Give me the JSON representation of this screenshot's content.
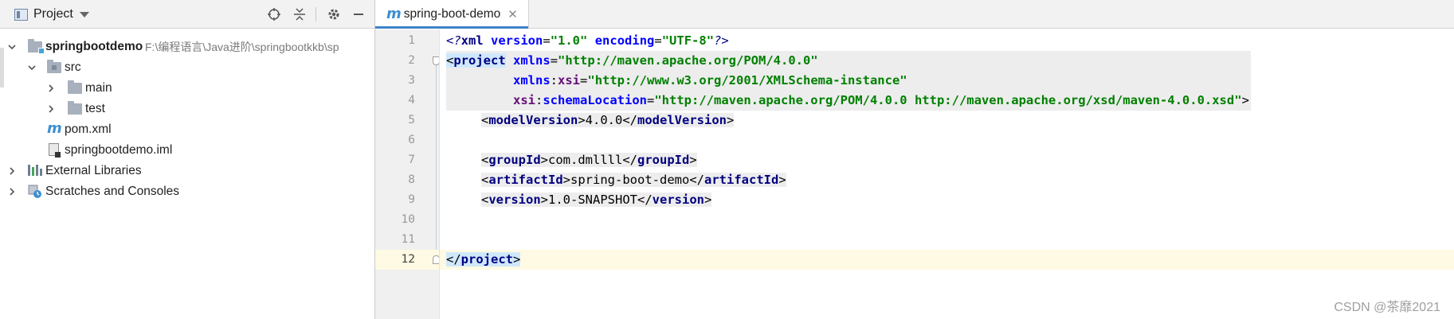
{
  "project_panel": {
    "title": "Project",
    "tree": [
      {
        "label": "springbootdemo",
        "hint": "F:\\编程语言\\Java进阶\\springbootkkb\\sp",
        "expanded": true,
        "icon": "module-folder-icon"
      },
      {
        "label": "src",
        "expanded": true,
        "icon": "source-folder-icon"
      },
      {
        "label": "main",
        "expanded": false,
        "icon": "folder-icon"
      },
      {
        "label": "test",
        "expanded": false,
        "icon": "folder-icon"
      },
      {
        "label": "pom.xml",
        "icon": "maven-icon"
      },
      {
        "label": "springbootdemo.iml",
        "icon": "iml-file-icon"
      },
      {
        "label": "External Libraries",
        "expanded": false,
        "icon": "library-icon"
      },
      {
        "label": "Scratches and Consoles",
        "expanded": false,
        "icon": "scratch-icon"
      }
    ]
  },
  "editor": {
    "tab_label": "spring-boot-demo",
    "line_numbers": [
      "1",
      "2",
      "3",
      "4",
      "5",
      "6",
      "7",
      "8",
      "9",
      "10",
      "11",
      "12"
    ],
    "current_line": 12,
    "code": {
      "l1_open": "<?",
      "l1_xml": "xml",
      "l1_version_attr": "version",
      "l1_version_val": "\"1.0\"",
      "l1_encoding_attr": "encoding",
      "l1_encoding_val": "\"UTF-8\"",
      "l1_close": "?>",
      "project_tag": "project",
      "xmlns_attr": "xmlns",
      "xmlns_val": "\"http://maven.apache.org/POM/4.0.0\"",
      "xsi_prefix": "xmlns",
      "xsi_ns": "xsi",
      "xsi_val": "\"http://www.w3.org/2001/XMLSchema-instance\"",
      "schema_ns": "xsi",
      "schema_attr": "schemaLocation",
      "schema_val": "\"http://maven.apache.org/POM/4.0.0 http://maven.apache.org/xsd/maven-4.0.0.xsd\"",
      "model_version_tag": "modelVersion",
      "model_version_val": "4.0.0",
      "group_id_tag": "groupId",
      "group_id_val": "com.dmllll",
      "artifact_id_tag": "artifactId",
      "artifact_id_val": "spring-boot-demo",
      "version_tag": "version",
      "version_val": "1.0-SNAPSHOT"
    }
  },
  "watermark": "CSDN @茶靡2021",
  "colors": {
    "tag": "#000080",
    "attribute": "#0000ff",
    "namespace": "#660e7a",
    "string": "#008000",
    "current_line": "#fffae3",
    "tag_highlight": "#cfe8fc"
  }
}
